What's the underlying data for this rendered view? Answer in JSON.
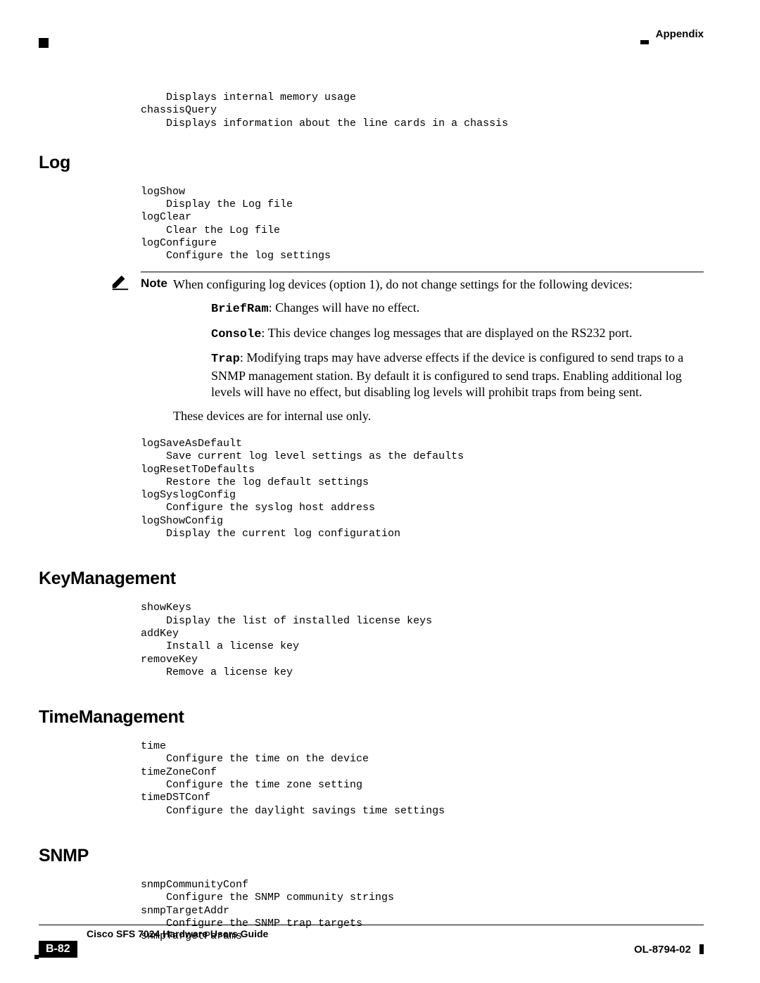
{
  "header": {
    "label": "Appendix"
  },
  "intro": {
    "code": "    Displays internal memory usage\nchassisQuery\n    Displays information about the line cards in a chassis"
  },
  "sections": {
    "log": {
      "heading": "Log",
      "code1": "logShow\n    Display the Log file\nlogClear\n    Clear the Log file\nlogConfigure\n    Configure the log settings",
      "note": {
        "label": "Note",
        "intro": "When configuring log devices (option 1), do not change settings for the following devices:",
        "briefram_cmd": "BriefRam",
        "briefram_text": ": Changes will have no effect.",
        "console_cmd": "Console",
        "console_text": ": This device changes log messages that are displayed on the RS232 port.",
        "trap_cmd": "Trap",
        "trap_text": ": Modifying traps may have adverse effects if the device is configured to send traps to a SNMP management station. By default it is configured to send traps. Enabling additional log levels will have no effect, but disabling log levels will prohibit traps from being sent.",
        "tail": "These devices are for internal use only."
      },
      "code2": "logSaveAsDefault\n    Save current log level settings as the defaults\nlogResetToDefaults\n    Restore the log default settings\nlogSyslogConfig\n    Configure the syslog host address\nlogShowConfig\n    Display the current log configuration"
    },
    "keymgmt": {
      "heading": "KeyManagement",
      "code": "showKeys\n    Display the list of installed license keys\naddKey\n    Install a license key\nremoveKey\n    Remove a license key"
    },
    "timemgmt": {
      "heading": "TimeManagement",
      "code": "time\n    Configure the time on the device\ntimeZoneConf\n    Configure the time zone setting\ntimeDSTConf\n    Configure the daylight savings time settings"
    },
    "snmp": {
      "heading": "SNMP",
      "code": "snmpCommunityConf\n    Configure the SNMP community strings\nsnmpTargetAddr\n    Configure the SNMP trap targets\nsnmpTargetParams"
    }
  },
  "footer": {
    "title": "Cisco SFS 7024 Hardware Users Guide",
    "page": "B-82",
    "docnum": "OL-8794-02"
  }
}
